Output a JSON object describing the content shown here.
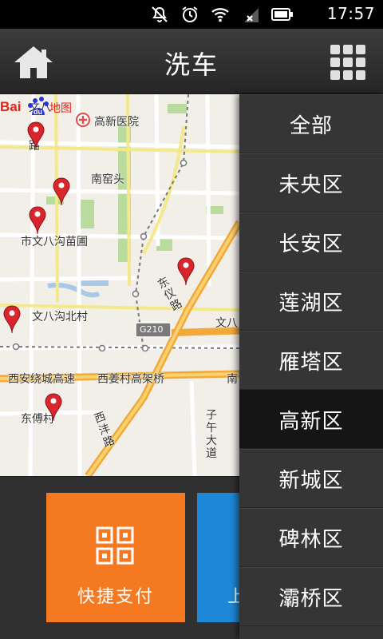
{
  "status_bar": {
    "time": "17:57",
    "icons": [
      "mute-icon",
      "alarm-icon",
      "wifi-icon",
      "signal-icon",
      "battery-icon"
    ]
  },
  "header": {
    "title": "洗车",
    "left_icon": "home-icon",
    "right_icon": "grid-menu-icon"
  },
  "map": {
    "labels": {
      "wenba_top": "文八",
      "wenba_lu": "路",
      "gaoxin_hospital": "高新医院",
      "nanyaotou": "南窑头",
      "wenbagou_nursery": "市文八沟苗圃",
      "wenbagou_north": "文八沟北村",
      "dongyi_road": "东仪路",
      "g210": "G210",
      "wenba_right": "文八",
      "xian_ring_expressway": "西安绕城高速",
      "xijiang_viaduct": "西姜村高架桥",
      "nan": "南",
      "dongfu_village": "东傅村",
      "xifeng_road": "西沣路",
      "ziwu_avenue": "子午大道"
    },
    "logo_text": "Bai du 地图"
  },
  "bottom": {
    "quick_pay_label": "快捷支付",
    "second_tile_label": "上"
  },
  "district_menu": {
    "items": [
      "全部",
      "未央区",
      "长安区",
      "莲湖区",
      "雁塔区",
      "高新区",
      "新城区",
      "碑林区",
      "灞桥区"
    ],
    "selected": "高新区"
  },
  "colors": {
    "quick_pay_tile": "#f47920",
    "second_tile": "#1e88d8",
    "header_bg": "#303030",
    "menu_bg": "#353535",
    "menu_selected_bg": "#151515"
  }
}
